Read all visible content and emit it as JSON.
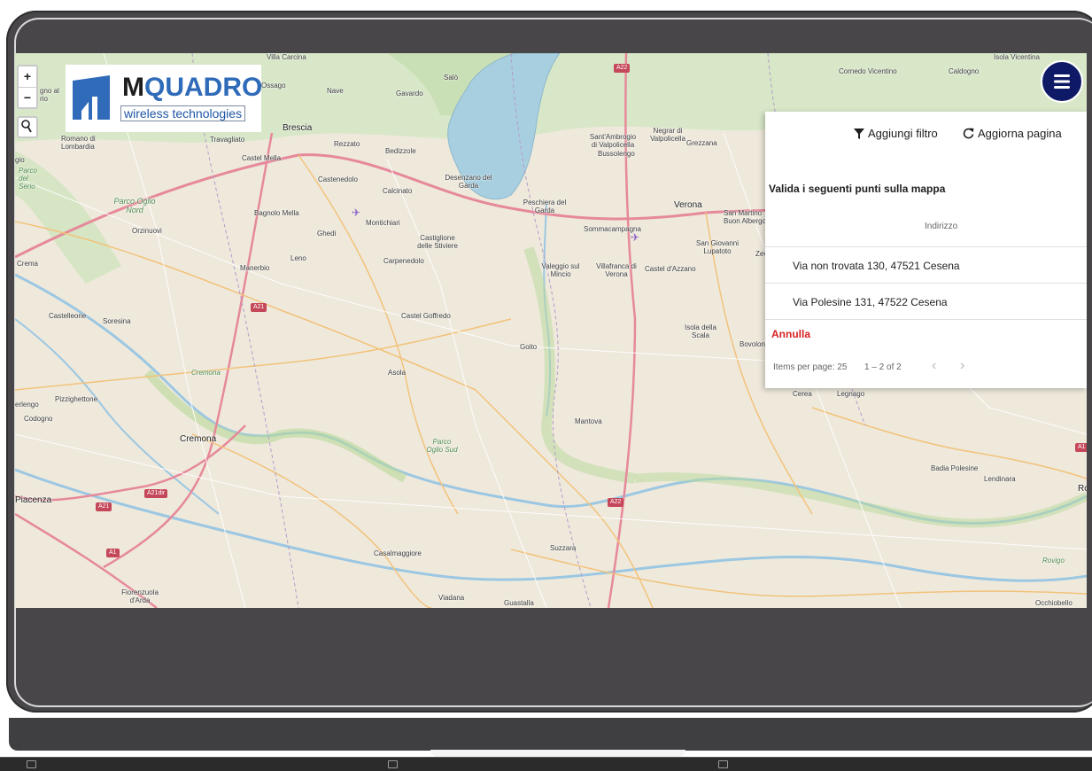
{
  "map": {
    "zoom_in": "+",
    "zoom_out": "−",
    "places": [
      {
        "label": "Villa Carcina",
        "cls": ""
      },
      {
        "label": "Nave",
        "cls": ""
      },
      {
        "label": "Gavardo",
        "cls": ""
      },
      {
        "label": "Salò",
        "cls": ""
      },
      {
        "label": "Brescia",
        "cls": "big"
      },
      {
        "label": "Travagliato",
        "cls": ""
      },
      {
        "label": "Rezzato",
        "cls": ""
      },
      {
        "label": "Bedizzole",
        "cls": ""
      },
      {
        "label": "Castel Mella",
        "cls": ""
      },
      {
        "label": "Castenedolo",
        "cls": ""
      },
      {
        "label": "Calcinato",
        "cls": ""
      },
      {
        "label": "Desenzano del Garda",
        "cls": ""
      },
      {
        "label": "Peschiera del Garda",
        "cls": ""
      },
      {
        "label": "Sant'Ambrogio di Valpolicella",
        "cls": ""
      },
      {
        "label": "Negrar di Valpolicella",
        "cls": ""
      },
      {
        "label": "Grezzana",
        "cls": ""
      },
      {
        "label": "Bussolengo",
        "cls": ""
      },
      {
        "label": "Verona",
        "cls": "big"
      },
      {
        "label": "Sommacampagna",
        "cls": ""
      },
      {
        "label": "San Martino Buon Albergo",
        "cls": ""
      },
      {
        "label": "San Giovanni Lupatoto",
        "cls": ""
      },
      {
        "label": "Cornedo Vicentino",
        "cls": ""
      },
      {
        "label": "Caldogno",
        "cls": ""
      },
      {
        "label": "Isola Vicentina",
        "cls": ""
      },
      {
        "label": "Romano di Lombardia",
        "cls": ""
      },
      {
        "label": "Parco del Serio",
        "cls": "it"
      },
      {
        "label": "Parco Oglio Nord",
        "cls": "it"
      },
      {
        "label": "Bagnolo Mella",
        "cls": ""
      },
      {
        "label": "Orzinuovi",
        "cls": ""
      },
      {
        "label": "Ghedi",
        "cls": ""
      },
      {
        "label": "Montichiari",
        "cls": ""
      },
      {
        "label": "Castiglione delle Stiviere",
        "cls": ""
      },
      {
        "label": "Leno",
        "cls": ""
      },
      {
        "label": "Manerbio",
        "cls": ""
      },
      {
        "label": "Carpenedolo",
        "cls": ""
      },
      {
        "label": "Valeggio sul Mincio",
        "cls": ""
      },
      {
        "label": "Villafranca di Verona",
        "cls": ""
      },
      {
        "label": "Castel d'Azzano",
        "cls": ""
      },
      {
        "label": "Crema",
        "cls": ""
      },
      {
        "label": "Castelleone",
        "cls": ""
      },
      {
        "label": "Soresina",
        "cls": ""
      },
      {
        "label": "Castel Goffredo",
        "cls": ""
      },
      {
        "label": "Isola della Scala",
        "cls": ""
      },
      {
        "label": "Bovolone",
        "cls": ""
      },
      {
        "label": "Goito",
        "cls": ""
      },
      {
        "label": "Cremona",
        "cls": "it"
      },
      {
        "label": "Asola",
        "cls": ""
      },
      {
        "label": "Pizzighettone",
        "cls": ""
      },
      {
        "label": "Codogno",
        "cls": ""
      },
      {
        "label": "Cremona",
        "cls": "big"
      },
      {
        "label": "Parco Oglio Sud",
        "cls": "it"
      },
      {
        "label": "Mantova",
        "cls": ""
      },
      {
        "label": "Cerea",
        "cls": ""
      },
      {
        "label": "Legnago",
        "cls": ""
      },
      {
        "label": "Badia Polesine",
        "cls": ""
      },
      {
        "label": "Lendinara",
        "cls": ""
      },
      {
        "label": "Piacenza",
        "cls": "big"
      },
      {
        "label": "Casalmaggiore",
        "cls": ""
      },
      {
        "label": "Suzzara",
        "cls": ""
      },
      {
        "label": "Rovigo",
        "cls": "it"
      },
      {
        "label": "Fiorenzuola d'Arda",
        "cls": ""
      },
      {
        "label": "Viadana",
        "cls": ""
      },
      {
        "label": "Guastalla",
        "cls": ""
      },
      {
        "label": "Occhiobello",
        "cls": ""
      },
      {
        "label": "Ossago",
        "cls": ""
      },
      {
        "label": "gno al rio",
        "cls": ""
      },
      {
        "label": "gio",
        "cls": ""
      },
      {
        "label": "erlengo",
        "cls": ""
      },
      {
        "label": "Zev",
        "cls": ""
      },
      {
        "label": "Ro",
        "cls": ""
      }
    ],
    "shields": [
      "A22",
      "A21",
      "A21dir",
      "A21",
      "A1",
      "A22",
      "A1"
    ]
  },
  "logo": {
    "name_m": "M",
    "name_rest": "QUADRO",
    "subtitle": "wireless technologies"
  },
  "panel": {
    "add_filter": "Aggiungi filtro",
    "refresh": "Aggiorna pagina",
    "title": "Valida i seguenti punti sulla mappa",
    "column_address": "Indirizzo",
    "rows": [
      "Via non trovata 130, 47521 Cesena",
      "Via Polesine 131, 47522 Cesena"
    ],
    "cancel": "Annulla",
    "items_per_page": "Items per page: 25",
    "range": "1 – 2 of 2"
  },
  "colors": {
    "fab": "#0e1a66",
    "cancel": "#d62323",
    "brand_blue": "#2f6bb8"
  }
}
